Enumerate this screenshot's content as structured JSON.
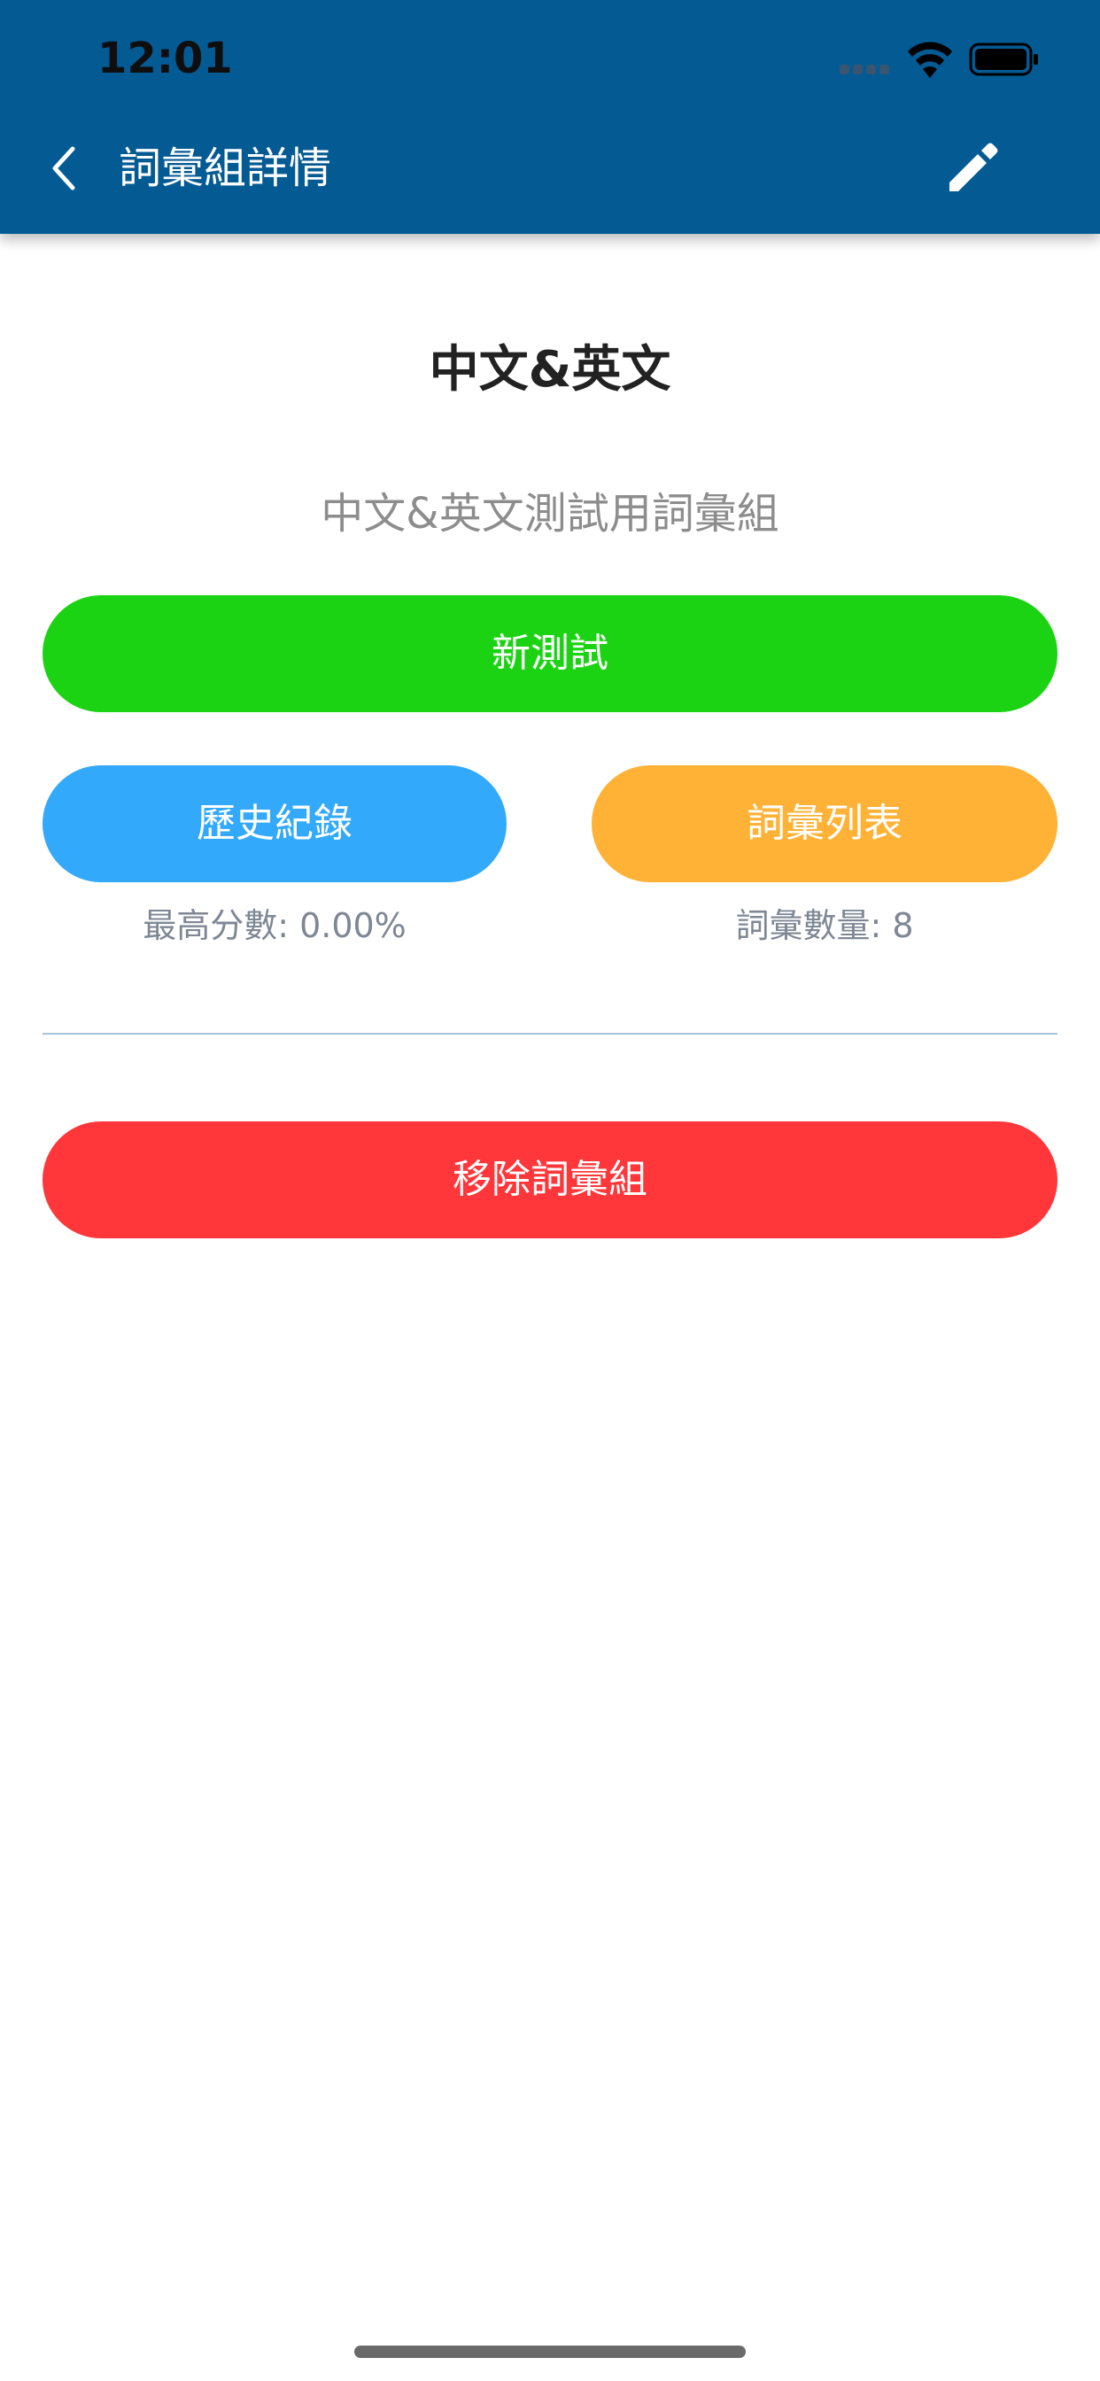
{
  "status_bar": {
    "time": "12:01"
  },
  "nav": {
    "title": "詞彙組詳情",
    "back_icon": "chevron-left-icon",
    "edit_icon": "pencil-icon"
  },
  "wordset": {
    "title": "中文&英文",
    "description": "中文&英文測試用詞彙組"
  },
  "actions": {
    "new_test_label": "新測試",
    "history_label": "歷史紀錄",
    "wordlist_label": "詞彙列表",
    "remove_label": "移除詞彙組"
  },
  "stats": {
    "best_score": "最高分數: 0.00%",
    "word_count": "詞彙數量: 8"
  },
  "colors": {
    "header": "#045a93",
    "new_test": "#1bd313",
    "history": "#33a9fb",
    "wordlist": "#ffb236",
    "remove": "#ff363a"
  }
}
